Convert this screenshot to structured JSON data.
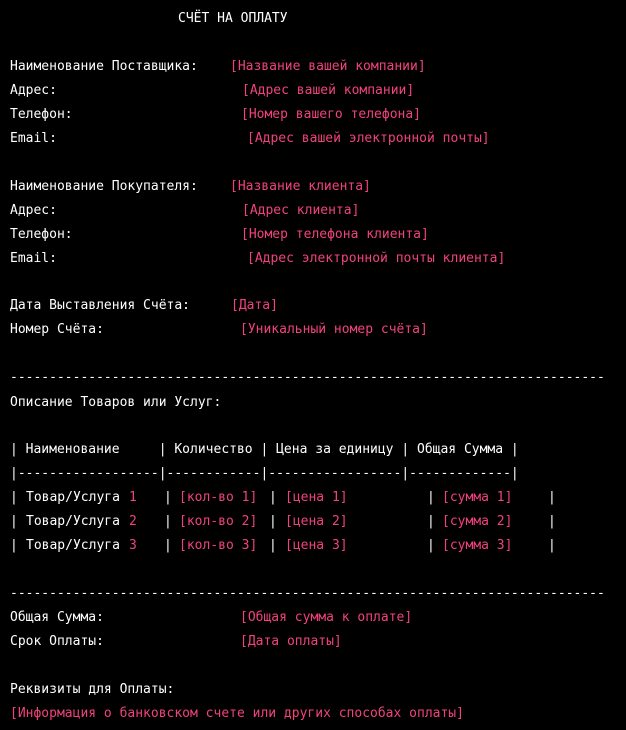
{
  "title": "СЧЁТ НА ОПЛАТУ",
  "supplier": {
    "name_label": "Наименование Поставщика:",
    "name_value": "[Название вашей компании]",
    "address_label": "Адрес:",
    "address_value": "[Адрес вашей компании]",
    "phone_label": "Телефон:",
    "phone_value": "[Номер вашего телефона]",
    "email_label": "Email:",
    "email_value": "[Адрес вашей электронной почты]"
  },
  "buyer": {
    "name_label": "Наименование Покупателя:",
    "name_value": "[Название клиента]",
    "address_label": "Адрес:",
    "address_value": "[Адрес клиента]",
    "phone_label": "Телефон:",
    "phone_value": "[Номер телефона клиента]",
    "email_label": "Email:",
    "email_value": "[Адрес электронной почты клиента]"
  },
  "invoice": {
    "date_label": "Дата Выставления Счёта:",
    "date_value": "[Дата]",
    "number_label": "Номер Счёта:",
    "number_value": "[Уникальный номер счёта]"
  },
  "divider": "----------------------------------------------------------------------------",
  "goods_label": "Описание Товаров или Услуг:",
  "table": {
    "header": "| Наименование     | Количество | Цена за единицу | Общая Сумма |",
    "separator": "|------------------|------------|-----------------|-------------|",
    "rows": [
      {
        "name": "Товар/Услуга",
        "num": "1",
        "qty": "[кол-во 1]",
        "price": "[цена 1]",
        "sum": "[сумма 1]"
      },
      {
        "name": "Товар/Услуга",
        "num": "2",
        "qty": "[кол-во 2]",
        "price": "[цена 2]",
        "sum": "[сумма 2]"
      },
      {
        "name": "Товар/Услуга",
        "num": "3",
        "qty": "[кол-во 3]",
        "price": "[цена 3]",
        "sum": "[сумма 3]"
      }
    ]
  },
  "totals": {
    "total_label": "Общая Сумма:",
    "total_value": "[Общая сумма к оплате]",
    "due_label": "Срок Оплаты:",
    "due_value": "[Дата оплаты]"
  },
  "payment": {
    "label": "Реквизиты для Оплаты:",
    "value": "[Информация о банковском счете или других способах оплаты]"
  },
  "colors": {
    "background": "#000000",
    "text": "#ffffff",
    "placeholder": "#f0437a"
  }
}
